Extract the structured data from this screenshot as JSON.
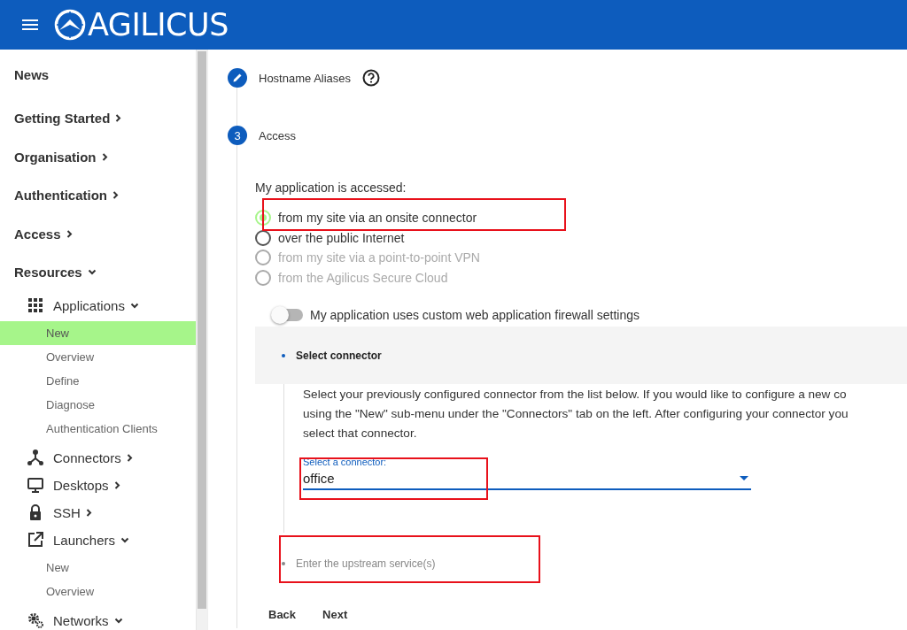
{
  "header": {
    "brand": "AGILICUS"
  },
  "sidebar": {
    "items": [
      {
        "label": "News"
      },
      {
        "label": "Getting Started",
        "expanded": false
      },
      {
        "label": "Organisation",
        "expanded": false
      },
      {
        "label": "Authentication",
        "expanded": false
      },
      {
        "label": "Access",
        "expanded": false
      },
      {
        "label": "Resources",
        "expanded": true,
        "children": [
          {
            "label": "Applications",
            "expanded": true,
            "children": [
              {
                "label": "New",
                "selected": true
              },
              {
                "label": "Overview",
                "selected": false
              },
              {
                "label": "Define",
                "selected": false
              },
              {
                "label": "Diagnose",
                "selected": false
              },
              {
                "label": "Authentication Clients",
                "selected": false
              }
            ]
          },
          {
            "label": "Connectors",
            "expanded": false
          },
          {
            "label": "Desktops",
            "expanded": false
          },
          {
            "label": "SSH",
            "expanded": false
          },
          {
            "label": "Launchers",
            "expanded": true,
            "children": [
              {
                "label": "New",
                "selected": false
              },
              {
                "label": "Overview",
                "selected": false
              }
            ]
          },
          {
            "label": "Networks",
            "expanded": true
          }
        ]
      }
    ]
  },
  "steps": [
    {
      "kind": "edit",
      "title": "Hostname Aliases",
      "help": true
    },
    {
      "kind": "number",
      "number": "3",
      "title": "Access"
    }
  ],
  "access": {
    "question": "My application is accessed:",
    "options": [
      {
        "label": "from my site via an onsite connector",
        "selected": true,
        "disabled": false
      },
      {
        "label": "over the public Internet",
        "selected": false,
        "disabled": false
      },
      {
        "label": "from my site via a point-to-point VPN",
        "selected": false,
        "disabled": true
      },
      {
        "label": "from the Agilicus Secure Cloud",
        "selected": false,
        "disabled": true
      }
    ],
    "toggle": {
      "label": "My application uses custom web application firewall settings",
      "on": false
    }
  },
  "substeps": [
    {
      "title": "Select connector",
      "active": true,
      "description": [
        "Select your previously configured connector from the list below. If you would like to configure a new co",
        "using the \"New\" sub-menu under the \"Connectors\" tab on the left. After configuring your connector you",
        "select that connector."
      ],
      "select": {
        "label": "Select a connector:",
        "value": "office"
      }
    },
    {
      "title": "Enter the upstream service(s)",
      "active": false
    }
  ],
  "buttons": [
    "Back",
    "Next"
  ]
}
